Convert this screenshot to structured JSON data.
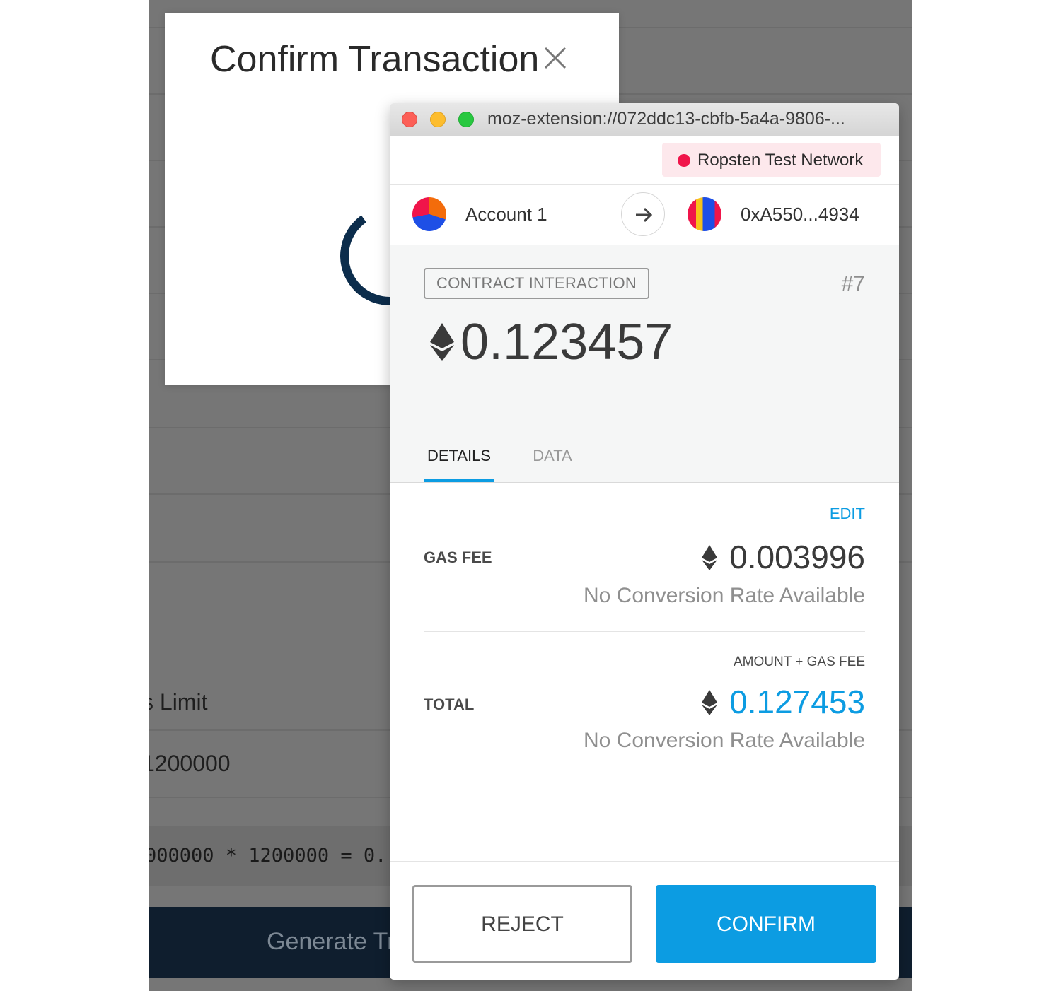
{
  "background_page": {
    "gas_limit_label": "s Limit",
    "gas_limit_value": "1200000",
    "formula": "000000 * 1200000 = 0.",
    "generate_button_label": "Generate Tr"
  },
  "modal": {
    "title": "Confirm Transaction"
  },
  "popup": {
    "url": "moz-extension://072ddc13-cbfb-5a4a-9806-...",
    "network": "Ropsten Test Network",
    "from_account": "Account 1",
    "to_address": "0xA550...4934",
    "tx_type": "CONTRACT INTERACTION",
    "nonce": "#7",
    "amount": "0.123457",
    "tabs": [
      "DETAILS",
      "DATA"
    ],
    "active_tab": "DETAILS",
    "edit_label": "EDIT",
    "gas_fee_label": "GAS FEE",
    "gas_fee_value": "0.003996",
    "gas_fee_fiat": "No Conversion Rate Available",
    "total_sublabel": "AMOUNT + GAS FEE",
    "total_label": "TOTAL",
    "total_value": "0.127453",
    "total_fiat": "No Conversion Rate Available",
    "reject_label": "REJECT",
    "confirm_label": "CONFIRM"
  },
  "colors": {
    "accent": "#0c9ce2",
    "network_dot": "#f0154a",
    "network_pill": "#fde8ec",
    "background_overlay": "#767676",
    "modal_spinner": "#0c2d4c"
  },
  "icons": {
    "close": "close-icon",
    "arrow": "arrow-right-icon",
    "eth": "ethereum-icon"
  }
}
